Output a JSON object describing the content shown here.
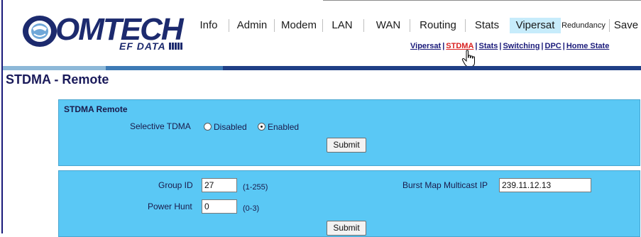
{
  "brand": {
    "name": "OMTECH",
    "tagline": "EF DATA"
  },
  "nav": {
    "tabs": [
      "Info",
      "Admin",
      "Modem",
      "LAN",
      "WAN",
      "Routing",
      "Stats",
      "Vipersat",
      "Redundancy",
      "Save"
    ],
    "selected": "Vipersat"
  },
  "subnav": {
    "links": [
      "Vipersat",
      "STDMA",
      "Stats",
      "Switching",
      "DPC",
      "Home State"
    ],
    "active": "STDMA",
    "separator": "|"
  },
  "colors": {
    "panel_bg": "#5ac8f5",
    "nav_selected": "#c7ecfb",
    "brand_blue": "#1c2a6e",
    "active_link": "#d92020"
  },
  "page": {
    "title": "STDMA - Remote"
  },
  "stdma_panel": {
    "title": "STDMA Remote",
    "selective_tdma_label": "Selective TDMA",
    "options": [
      "Disabled",
      "Enabled"
    ],
    "selected_option": "Enabled",
    "submit_label": "Submit"
  },
  "group_panel": {
    "group_id_label": "Group ID",
    "group_id_value": "27",
    "group_id_range": "(1-255)",
    "power_hunt_label": "Power Hunt",
    "power_hunt_value": "0",
    "power_hunt_range": "(0-3)",
    "burst_map_label": "Burst Map Multicast IP",
    "burst_map_value": "239.11.12.13",
    "submit_label": "Submit"
  }
}
